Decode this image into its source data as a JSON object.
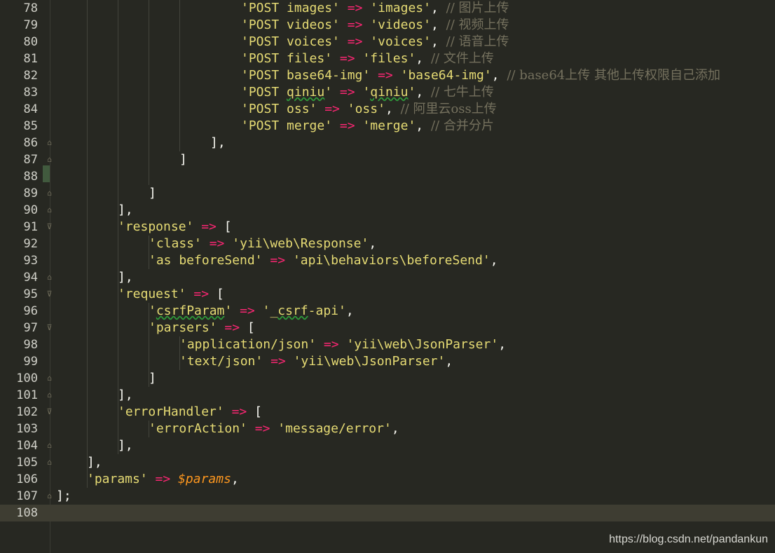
{
  "editor": {
    "current_line": "108",
    "lines": [
      {
        "num": "78",
        "indent": 6,
        "guides": 4,
        "fold": "",
        "mark": false,
        "segs": [
          [
            "str",
            "'POST images'"
          ],
          [
            "p",
            " "
          ],
          [
            "op",
            "=>"
          ],
          [
            "p",
            " "
          ],
          [
            "str",
            "'images'"
          ],
          [
            "p",
            ", "
          ],
          [
            "cm",
            "// 图片上传"
          ]
        ]
      },
      {
        "num": "79",
        "indent": 6,
        "guides": 4,
        "fold": "",
        "mark": false,
        "segs": [
          [
            "str",
            "'POST videos'"
          ],
          [
            "p",
            " "
          ],
          [
            "op",
            "=>"
          ],
          [
            "p",
            " "
          ],
          [
            "str",
            "'videos'"
          ],
          [
            "p",
            ", "
          ],
          [
            "cm",
            "// 视频上传"
          ]
        ]
      },
      {
        "num": "80",
        "indent": 6,
        "guides": 4,
        "fold": "",
        "mark": false,
        "segs": [
          [
            "str",
            "'POST voices'"
          ],
          [
            "p",
            " "
          ],
          [
            "op",
            "=>"
          ],
          [
            "p",
            " "
          ],
          [
            "str",
            "'voices'"
          ],
          [
            "p",
            ", "
          ],
          [
            "cm",
            "// 语音上传"
          ]
        ]
      },
      {
        "num": "81",
        "indent": 6,
        "guides": 4,
        "fold": "",
        "mark": false,
        "segs": [
          [
            "str",
            "'POST files'"
          ],
          [
            "p",
            " "
          ],
          [
            "op",
            "=>"
          ],
          [
            "p",
            " "
          ],
          [
            "str",
            "'files'"
          ],
          [
            "p",
            ", "
          ],
          [
            "cm",
            "// 文件上传"
          ]
        ]
      },
      {
        "num": "82",
        "indent": 6,
        "guides": 4,
        "fold": "",
        "mark": false,
        "segs": [
          [
            "str",
            "'POST base64-img'"
          ],
          [
            "p",
            " "
          ],
          [
            "op",
            "=>"
          ],
          [
            "p",
            " "
          ],
          [
            "str",
            "'base64-img'"
          ],
          [
            "p",
            ", "
          ],
          [
            "cm",
            "// base64上传 其他上传权限自己添加"
          ]
        ]
      },
      {
        "num": "83",
        "indent": 6,
        "guides": 4,
        "fold": "",
        "mark": false,
        "segs": [
          [
            "str",
            "'POST "
          ],
          [
            "sq",
            "qiniu"
          ],
          [
            "str",
            "'"
          ],
          [
            "p",
            " "
          ],
          [
            "op",
            "=>"
          ],
          [
            "p",
            " "
          ],
          [
            "str",
            "'"
          ],
          [
            "sq",
            "qiniu"
          ],
          [
            "str",
            "'"
          ],
          [
            "p",
            ", "
          ],
          [
            "cm",
            "// 七牛上传"
          ]
        ]
      },
      {
        "num": "84",
        "indent": 6,
        "guides": 4,
        "fold": "",
        "mark": false,
        "segs": [
          [
            "str",
            "'POST oss'"
          ],
          [
            "p",
            " "
          ],
          [
            "op",
            "=>"
          ],
          [
            "p",
            " "
          ],
          [
            "str",
            "'oss'"
          ],
          [
            "p",
            ", "
          ],
          [
            "cm",
            "// 阿里云oss上传"
          ]
        ]
      },
      {
        "num": "85",
        "indent": 6,
        "guides": 4,
        "fold": "",
        "mark": false,
        "segs": [
          [
            "str",
            "'POST merge'"
          ],
          [
            "p",
            " "
          ],
          [
            "op",
            "=>"
          ],
          [
            "p",
            " "
          ],
          [
            "str",
            "'merge'"
          ],
          [
            "p",
            ", "
          ],
          [
            "cm",
            "// 合并分片"
          ]
        ]
      },
      {
        "num": "86",
        "indent": 5,
        "guides": 4,
        "fold": "end",
        "mark": false,
        "segs": [
          [
            "p",
            "],"
          ]
        ]
      },
      {
        "num": "87",
        "indent": 4,
        "guides": 3,
        "fold": "end",
        "mark": false,
        "segs": [
          [
            "p",
            "]"
          ]
        ]
      },
      {
        "num": "88",
        "indent": 0,
        "guides": 3,
        "fold": "",
        "mark": true,
        "segs": []
      },
      {
        "num": "89",
        "indent": 3,
        "guides": 2,
        "fold": "end",
        "mark": false,
        "segs": [
          [
            "p",
            "]"
          ]
        ]
      },
      {
        "num": "90",
        "indent": 2,
        "guides": 2,
        "fold": "end",
        "mark": false,
        "segs": [
          [
            "p",
            "],"
          ]
        ]
      },
      {
        "num": "91",
        "indent": 2,
        "guides": 2,
        "fold": "start",
        "mark": false,
        "segs": [
          [
            "str",
            "'response'"
          ],
          [
            "p",
            " "
          ],
          [
            "op",
            "=>"
          ],
          [
            "p",
            " ["
          ]
        ]
      },
      {
        "num": "92",
        "indent": 3,
        "guides": 3,
        "fold": "",
        "mark": false,
        "segs": [
          [
            "str",
            "'class'"
          ],
          [
            "p",
            " "
          ],
          [
            "op",
            "=>"
          ],
          [
            "p",
            " "
          ],
          [
            "str",
            "'yii\\web\\Response'"
          ],
          [
            "p",
            ","
          ]
        ]
      },
      {
        "num": "93",
        "indent": 3,
        "guides": 3,
        "fold": "",
        "mark": false,
        "segs": [
          [
            "str",
            "'as beforeSend'"
          ],
          [
            "p",
            " "
          ],
          [
            "op",
            "=>"
          ],
          [
            "p",
            " "
          ],
          [
            "str",
            "'api\\behaviors\\beforeSend'"
          ],
          [
            "p",
            ","
          ]
        ]
      },
      {
        "num": "94",
        "indent": 2,
        "guides": 2,
        "fold": "end",
        "mark": false,
        "segs": [
          [
            "p",
            "],"
          ]
        ]
      },
      {
        "num": "95",
        "indent": 2,
        "guides": 2,
        "fold": "start",
        "mark": false,
        "segs": [
          [
            "str",
            "'request'"
          ],
          [
            "p",
            " "
          ],
          [
            "op",
            "=>"
          ],
          [
            "p",
            " ["
          ]
        ]
      },
      {
        "num": "96",
        "indent": 3,
        "guides": 3,
        "fold": "",
        "mark": false,
        "segs": [
          [
            "str",
            "'"
          ],
          [
            "sq",
            "csrfParam"
          ],
          [
            "str",
            "'"
          ],
          [
            "p",
            " "
          ],
          [
            "op",
            "=>"
          ],
          [
            "p",
            " "
          ],
          [
            "str",
            "'_"
          ],
          [
            "sq",
            "csrf"
          ],
          [
            "str",
            "-api'"
          ],
          [
            "p",
            ","
          ]
        ]
      },
      {
        "num": "97",
        "indent": 3,
        "guides": 3,
        "fold": "start",
        "mark": false,
        "segs": [
          [
            "str",
            "'parsers'"
          ],
          [
            "p",
            " "
          ],
          [
            "op",
            "=>"
          ],
          [
            "p",
            " ["
          ]
        ]
      },
      {
        "num": "98",
        "indent": 4,
        "guides": 4,
        "fold": "",
        "mark": false,
        "segs": [
          [
            "str",
            "'application/json'"
          ],
          [
            "p",
            " "
          ],
          [
            "op",
            "=>"
          ],
          [
            "p",
            " "
          ],
          [
            "str",
            "'yii\\web\\JsonParser'"
          ],
          [
            "p",
            ","
          ]
        ]
      },
      {
        "num": "99",
        "indent": 4,
        "guides": 4,
        "fold": "",
        "mark": false,
        "segs": [
          [
            "str",
            "'text/json'"
          ],
          [
            "p",
            " "
          ],
          [
            "op",
            "=>"
          ],
          [
            "p",
            " "
          ],
          [
            "str",
            "'yii\\web\\JsonParser'"
          ],
          [
            "p",
            ","
          ]
        ]
      },
      {
        "num": "100",
        "indent": 3,
        "guides": 3,
        "fold": "end",
        "mark": false,
        "segs": [
          [
            "p",
            "]"
          ]
        ]
      },
      {
        "num": "101",
        "indent": 2,
        "guides": 2,
        "fold": "end",
        "mark": false,
        "segs": [
          [
            "p",
            "],"
          ]
        ]
      },
      {
        "num": "102",
        "indent": 2,
        "guides": 2,
        "fold": "start",
        "mark": false,
        "segs": [
          [
            "str",
            "'errorHandler'"
          ],
          [
            "p",
            " "
          ],
          [
            "op",
            "=>"
          ],
          [
            "p",
            " ["
          ]
        ]
      },
      {
        "num": "103",
        "indent": 3,
        "guides": 3,
        "fold": "",
        "mark": false,
        "segs": [
          [
            "str",
            "'errorAction'"
          ],
          [
            "p",
            " "
          ],
          [
            "op",
            "=>"
          ],
          [
            "p",
            " "
          ],
          [
            "str",
            "'message/error'"
          ],
          [
            "p",
            ","
          ]
        ]
      },
      {
        "num": "104",
        "indent": 2,
        "guides": 2,
        "fold": "end",
        "mark": false,
        "segs": [
          [
            "p",
            "],"
          ]
        ]
      },
      {
        "num": "105",
        "indent": 1,
        "guides": 1,
        "fold": "end",
        "mark": false,
        "segs": [
          [
            "p",
            "],"
          ]
        ]
      },
      {
        "num": "106",
        "indent": 1,
        "guides": 1,
        "fold": "",
        "mark": false,
        "segs": [
          [
            "str",
            "'params'"
          ],
          [
            "p",
            " "
          ],
          [
            "op",
            "=>"
          ],
          [
            "p",
            " "
          ],
          [
            "var",
            "$params"
          ],
          [
            "p",
            ","
          ]
        ]
      },
      {
        "num": "107",
        "indent": 0,
        "guides": 0,
        "fold": "end",
        "mark": false,
        "segs": [
          [
            "p",
            "];"
          ]
        ]
      },
      {
        "num": "108",
        "indent": 0,
        "guides": 0,
        "fold": "",
        "mark": false,
        "segs": []
      }
    ]
  },
  "watermark": "https://blog.csdn.net/pandankun"
}
